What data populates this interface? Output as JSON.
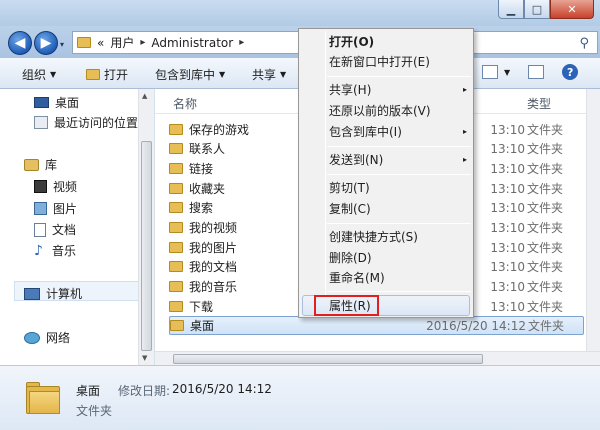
{
  "window": {
    "minimize_glyph": "▁",
    "maximize_glyph": "□",
    "close_glyph": "✕"
  },
  "address": {
    "overflow": "«",
    "crumbs": [
      "用户",
      "Administrator"
    ],
    "separator": "▸",
    "dropdown": "▾"
  },
  "toolbar": {
    "organize": "组织",
    "open": "打开",
    "include_library": "包含到库中",
    "share": "共享",
    "help": "?"
  },
  "nav": {
    "desktop": "桌面",
    "recent": "最近访问的位置",
    "libraries": "库",
    "videos": "视频",
    "pictures": "图片",
    "documents": "文档",
    "music": "音乐",
    "computer": "计算机",
    "network": "网络"
  },
  "columns": {
    "name": "名称",
    "type": "类型"
  },
  "files": [
    {
      "name": "保存的游戏",
      "date": "13:10",
      "type": "文件夹"
    },
    {
      "name": "联系人",
      "date": "13:10",
      "type": "文件夹"
    },
    {
      "name": "链接",
      "date": "13:10",
      "type": "文件夹"
    },
    {
      "name": "收藏夹",
      "date": "13:10",
      "type": "文件夹"
    },
    {
      "name": "搜索",
      "date": "13:10",
      "type": "文件夹"
    },
    {
      "name": "我的视频",
      "date": "13:10",
      "type": "文件夹"
    },
    {
      "name": "我的图片",
      "date": "13:10",
      "type": "文件夹"
    },
    {
      "name": "我的文档",
      "date": "13:10",
      "type": "文件夹"
    },
    {
      "name": "我的音乐",
      "date": "13:10",
      "type": "文件夹"
    },
    {
      "name": "下载",
      "date": "13:10",
      "type": "文件夹"
    },
    {
      "name": "桌面",
      "date": "2016/5/20 14:12",
      "type": "文件夹"
    }
  ],
  "details": {
    "name": "桌面",
    "modified_label": "修改日期:",
    "modified_value": "2016/5/20 14:12",
    "type": "文件夹"
  },
  "context_menu": {
    "open": "打开(O)",
    "open_new_window": "在新窗口中打开(E)",
    "share_with": "共享(H)",
    "restore_previous": "还原以前的版本(V)",
    "include_library": "包含到库中(I)",
    "send_to": "发送到(N)",
    "cut": "剪切(T)",
    "copy": "复制(C)",
    "create_shortcut": "创建快捷方式(S)",
    "delete": "删除(D)",
    "rename": "重命名(M)",
    "properties": "属性(R)",
    "submenu_arrow": "▸"
  },
  "colors": {
    "highlight_box": "#e02020",
    "selection": "#cfe2f7",
    "folder": "#e7be55"
  }
}
